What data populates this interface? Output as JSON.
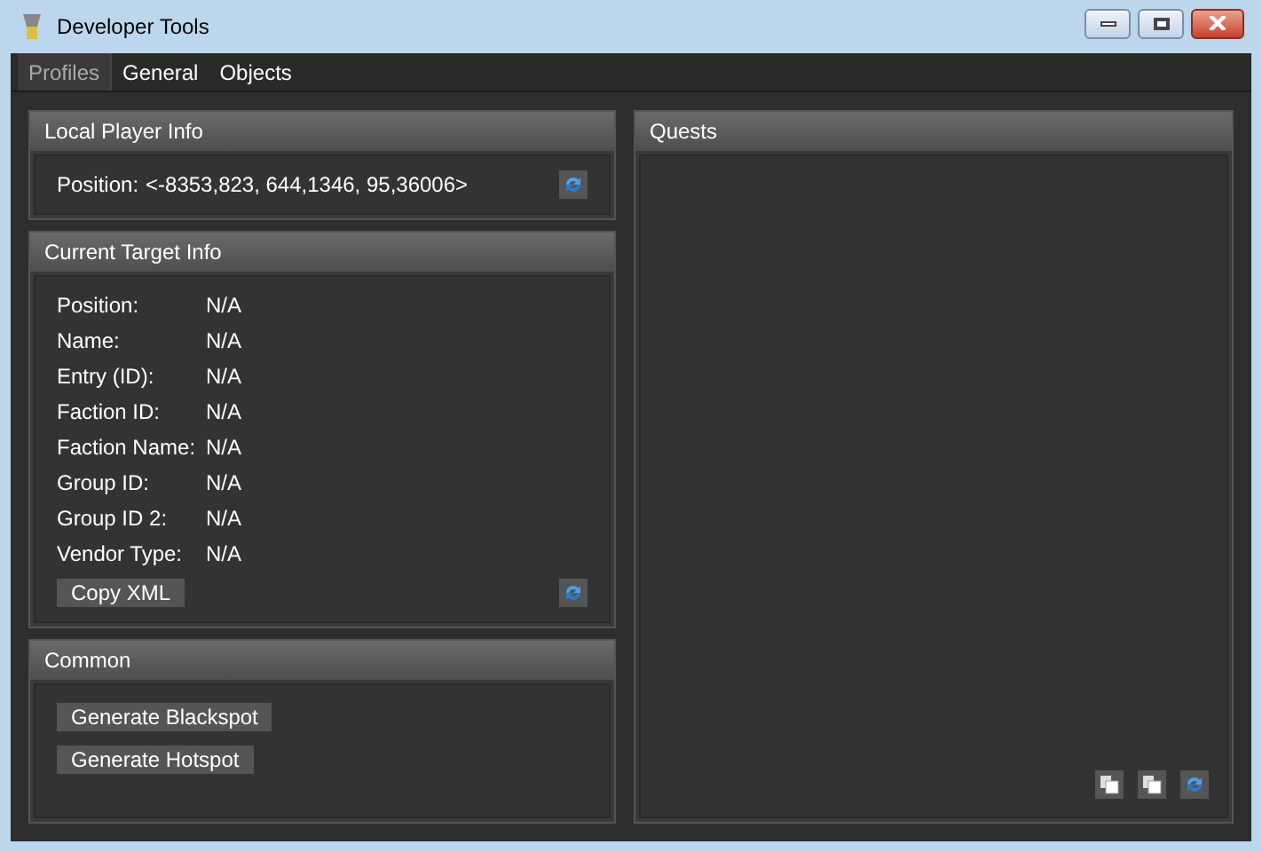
{
  "window": {
    "title": "Developer Tools"
  },
  "tabs": [
    {
      "label": "Profiles",
      "selected": true
    },
    {
      "label": "General",
      "selected": false
    },
    {
      "label": "Objects",
      "selected": false
    }
  ],
  "local_player": {
    "title": "Local Player Info",
    "label": "Position:",
    "value": "<-8353,823, 644,1346, 95,36006>"
  },
  "current_target": {
    "title": "Current Target Info",
    "fields": [
      {
        "label": "Position:",
        "value": "N/A"
      },
      {
        "label": "Name:",
        "value": "N/A"
      },
      {
        "label": "Entry (ID):",
        "value": "N/A"
      },
      {
        "label": "Faction ID:",
        "value": "N/A"
      },
      {
        "label": "Faction Name:",
        "value": "N/A"
      },
      {
        "label": "Group ID:",
        "value": "N/A"
      },
      {
        "label": "Group ID 2:",
        "value": "N/A"
      },
      {
        "label": "Vendor Type:",
        "value": "N/A"
      }
    ],
    "button": "Copy XML"
  },
  "common": {
    "title": "Common",
    "buttons": [
      "Generate Blackspot",
      "Generate Hotspot"
    ]
  },
  "quests": {
    "title": "Quests"
  }
}
